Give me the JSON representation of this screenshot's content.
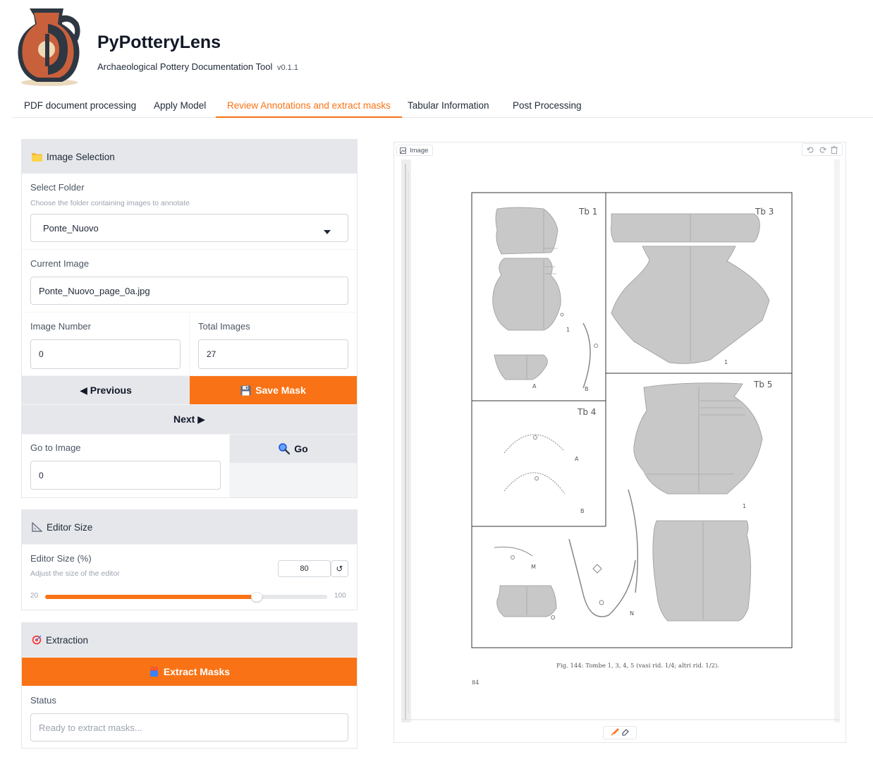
{
  "header": {
    "title": "PyPotteryLens",
    "subtitle": "Archaeological Pottery Documentation Tool",
    "version": "v0.1.1"
  },
  "tabs": [
    {
      "label": "PDF document processing",
      "active": false
    },
    {
      "label": "Apply Model",
      "active": false
    },
    {
      "label": "Review Annotations and extract masks",
      "active": true
    },
    {
      "label": "Tabular Information",
      "active": false
    },
    {
      "label": "Post Processing",
      "active": false
    }
  ],
  "image_selection": {
    "title": "Image Selection",
    "icon": "folder-icon",
    "folder_label": "Select Folder",
    "folder_info": "Choose the folder containing images to annotate",
    "folder_value": "Ponte_Nuovo",
    "current_label": "Current Image",
    "current_value": "Ponte_Nuovo_page_0a.jpg",
    "number_label": "Image Number",
    "number_value": "0",
    "total_label": "Total Images",
    "total_value": "27",
    "prev_label": "◀ Previous",
    "save_label": "Save Mask",
    "next_label": "Next ▶",
    "goto_label": "Go to Image",
    "goto_value": "0",
    "go_label": "Go"
  },
  "editor_size": {
    "title": "Editor Size",
    "label": "Editor Size (%)",
    "info": "Adjust the size of the editor",
    "value": 80,
    "min": 20,
    "max": 100
  },
  "extraction": {
    "title": "Extraction",
    "button_label": "Extract Masks",
    "status_label": "Status",
    "status_placeholder": "Ready to extract masks..."
  },
  "image_editor": {
    "label": "Image",
    "page": {
      "groups": [
        "Tb 1",
        "Tb 3",
        "Tb 4",
        "Tb 5"
      ],
      "tb1_labels": [
        "1",
        "A",
        "B"
      ],
      "tb3_labels": [
        "1"
      ],
      "tb4_labels": [
        "A",
        "B"
      ],
      "tb5_labels": [
        "1"
      ],
      "bottom_labels": [
        "M",
        "O",
        "N"
      ],
      "caption": "Fig. 144: Tombe 1, 3, 4, 5 (vasi rid. 1/4; altri rid. 1/2).",
      "page_number": "84"
    }
  },
  "colors": {
    "accent": "#f97316",
    "panel_bg": "#f3f4f6",
    "panel_header": "#e5e7eb",
    "mask_fill": "#c8c8c8",
    "logo_body": "#c8603c",
    "logo_dark": "#2e3742",
    "logo_light": "#f0d9b5"
  }
}
